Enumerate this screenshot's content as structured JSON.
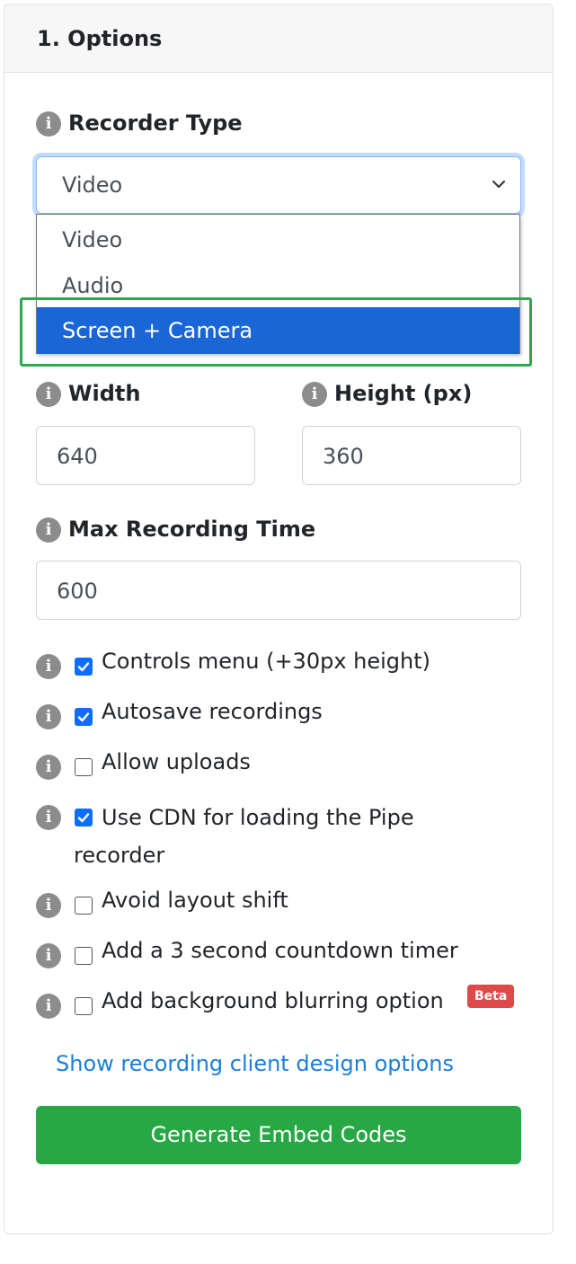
{
  "card": {
    "title": "1. Options"
  },
  "recorder_type": {
    "label": "Recorder Type",
    "selected": "Video",
    "options": [
      "Video",
      "Audio",
      "Screen + Camera"
    ],
    "highlighted_option": "Screen + Camera"
  },
  "dimensions": {
    "width_label": "Width",
    "width_value": "640",
    "height_label": "Height (px)",
    "height_value": "360"
  },
  "max_time": {
    "label": "Max Recording Time",
    "value": "600"
  },
  "checkboxes": [
    {
      "label": "Controls menu (+30px height)",
      "checked": true
    },
    {
      "label": "Autosave recordings",
      "checked": true
    },
    {
      "label": "Allow uploads",
      "checked": false
    },
    {
      "label": "Use CDN for loading the Pipe recorder",
      "checked": true
    },
    {
      "label": "Avoid layout shift",
      "checked": false
    },
    {
      "label": "Add a 3 second countdown timer",
      "checked": false
    },
    {
      "label": "Add background blurring option",
      "checked": false
    }
  ],
  "beta_badge": "Beta",
  "design_link": "Show recording client design options",
  "generate_button": "Generate Embed Codes",
  "icons": {
    "info": "info-icon",
    "chevron": "chevron-down-icon",
    "check": "checkmark-icon"
  },
  "colors": {
    "primary": "#0d6efd",
    "success": "#28a745",
    "selected_option": "#1a66d6",
    "danger": "#dc4a4a",
    "highlight": "#2ea84e"
  }
}
